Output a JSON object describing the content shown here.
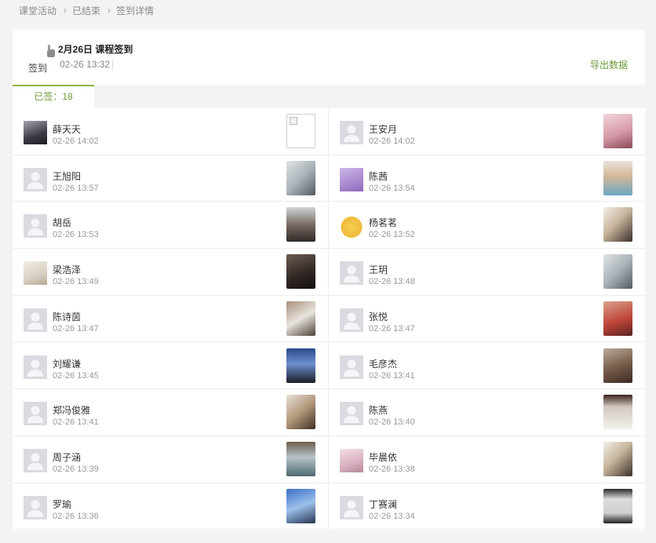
{
  "breadcrumb": [
    "课堂活动",
    "已结束",
    "签到详情"
  ],
  "activity": {
    "icon_label": "签到",
    "title": "2月26日 课程签到",
    "time": "02-26 13:32",
    "export_label": "导出数据"
  },
  "tabs": {
    "signed_label": "已签：18"
  },
  "students": [
    {
      "name": "薛天天",
      "time": "02-26 14:02",
      "avatar": "photo-avatar-dark",
      "photo": "broken-image"
    },
    {
      "name": "王安月",
      "time": "02-26 14:02",
      "avatar": "default-avatar",
      "photo": "selfie-pink"
    },
    {
      "name": "王旭阳",
      "time": "02-26 13:57",
      "avatar": "default-avatar",
      "photo": "room-photo"
    },
    {
      "name": "陈茜",
      "time": "02-26 13:54",
      "avatar": "cartoon-avatar-purple",
      "photo": "selfie-mask"
    },
    {
      "name": "胡岳",
      "time": "02-26 13:53",
      "avatar": "default-avatar",
      "photo": "selfie-glasses"
    },
    {
      "name": "杨茗茗",
      "time": "02-26 13:52",
      "avatar": "cartoon-avatar-chick",
      "photo": "desk-photo"
    },
    {
      "name": "梁浩泽",
      "time": "02-26 13:49",
      "avatar": "photo-avatar-light",
      "photo": "dark-room-photo"
    },
    {
      "name": "王玥",
      "time": "02-26 13:48",
      "avatar": "default-avatar",
      "photo": "room-photo"
    },
    {
      "name": "陈诗茵",
      "time": "02-26 13:47",
      "avatar": "default-avatar",
      "photo": "laptop-photo"
    },
    {
      "name": "张悦",
      "time": "02-26 13:47",
      "avatar": "default-avatar",
      "photo": "red-room-photo"
    },
    {
      "name": "刘耀谦",
      "time": "02-26 13:45",
      "avatar": "default-avatar",
      "photo": "screen-selfie"
    },
    {
      "name": "毛彦杰",
      "time": "02-26 13:41",
      "avatar": "default-avatar",
      "photo": "selfie-dark"
    },
    {
      "name": "郑冯俊雅",
      "time": "02-26 13:41",
      "avatar": "default-avatar",
      "photo": "window-photo"
    },
    {
      "name": "陈燕",
      "time": "02-26 13:40",
      "avatar": "default-avatar",
      "photo": "screen-photo"
    },
    {
      "name": "周子涵",
      "time": "02-26 13:39",
      "avatar": "default-avatar",
      "photo": "shelf-photo"
    },
    {
      "name": "毕晨依",
      "time": "02-26 13:38",
      "avatar": "photo-avatar-pink",
      "photo": "desk-photo"
    },
    {
      "name": "罗瑜",
      "time": "02-26 13:36",
      "avatar": "default-avatar",
      "photo": "blue-screen-photo"
    },
    {
      "name": "丁赛澜",
      "time": "02-26 13:34",
      "avatar": "default-avatar",
      "photo": "monitor-photo"
    }
  ],
  "colors": {
    "accent": "#6e9a3a",
    "tab_border": "#8fb64b",
    "avatar_bg": "#d9dbe1"
  }
}
